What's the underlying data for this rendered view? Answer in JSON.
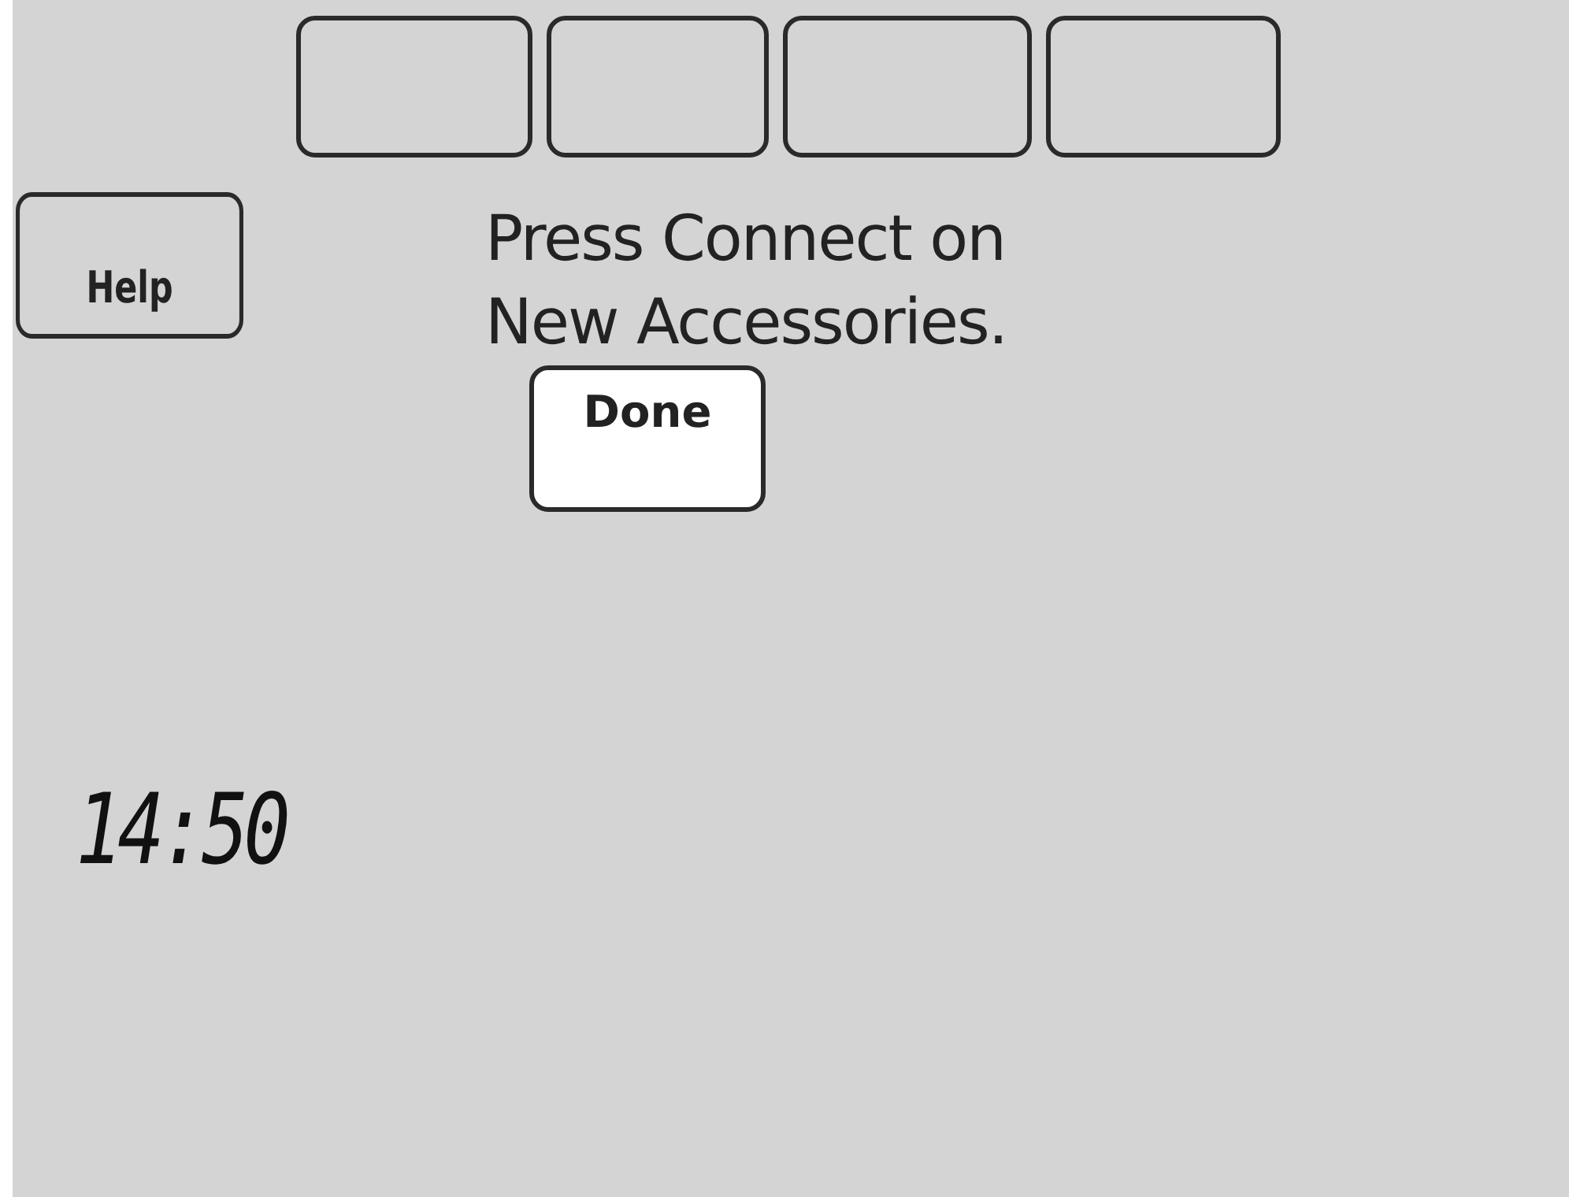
{
  "help_button": {
    "label": "Help"
  },
  "message": {
    "lines": [
      "Press Connect on",
      "New Accessories."
    ]
  },
  "done_button": {
    "label": "Done"
  },
  "clock": {
    "time": "14:50"
  }
}
